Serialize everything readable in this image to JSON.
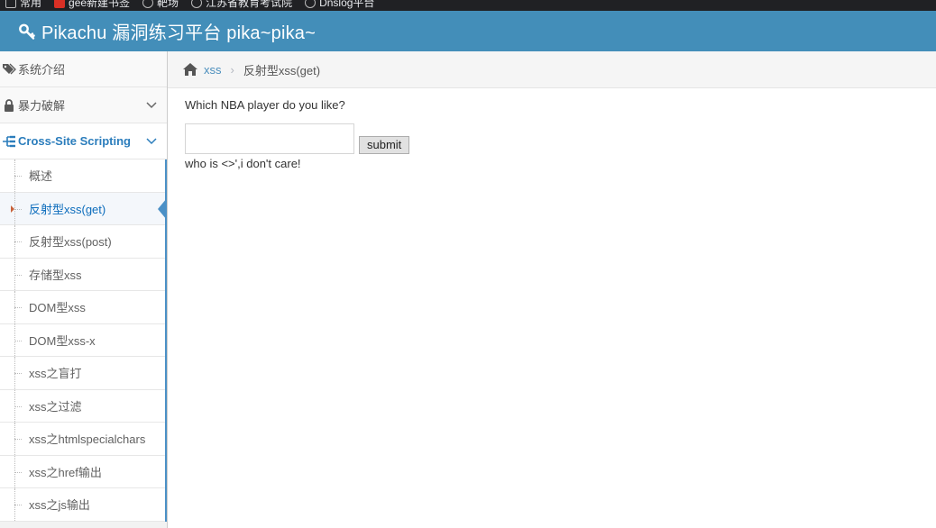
{
  "bookmarks": [
    {
      "label": "常用",
      "icon": "folder-icon"
    },
    {
      "label": "gee新建书签",
      "icon": "csdn-icon"
    },
    {
      "label": "靶场",
      "icon": "globe-icon"
    },
    {
      "label": "江苏省教育考试院",
      "icon": "globe-icon"
    },
    {
      "label": "Dnslog平台",
      "icon": "globe-icon"
    }
  ],
  "navbar": {
    "title": "Pikachu 漏洞练习平台 pika~pika~",
    "color": "#438eb9"
  },
  "sidebar": {
    "items": [
      {
        "label": "系统介绍",
        "icon": "tags-icon"
      },
      {
        "label": "暴力破解",
        "icon": "lock-icon"
      },
      {
        "label": "Cross-Site Scripting",
        "icon": "tree-icon"
      }
    ],
    "submenu": [
      {
        "label": "概述"
      },
      {
        "label": "反射型xss(get)"
      },
      {
        "label": "反射型xss(post)"
      },
      {
        "label": "存储型xss"
      },
      {
        "label": "DOM型xss"
      },
      {
        "label": "DOM型xss-x"
      },
      {
        "label": "xss之盲打"
      },
      {
        "label": "xss之过滤"
      },
      {
        "label": "xss之htmlspecialchars"
      },
      {
        "label": "xss之href输出"
      },
      {
        "label": "xss之js输出"
      }
    ]
  },
  "breadcrumb": {
    "link": "xss",
    "separator": "›",
    "current": "反射型xss(get)"
  },
  "form": {
    "question": "Which NBA player do you like?",
    "input_value": "",
    "submit_label": "submit",
    "result": "who is <>',i don't care!"
  }
}
